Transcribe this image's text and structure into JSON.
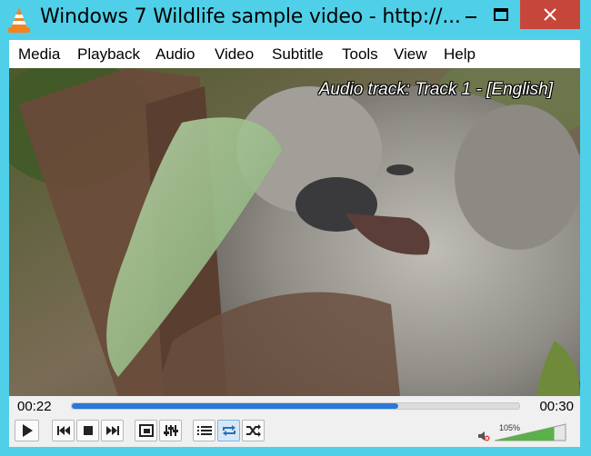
{
  "window": {
    "title": "Windows 7 Wildlife sample video - http://..."
  },
  "menu": {
    "items": [
      "Media",
      "Playback",
      "Audio",
      "Video",
      "Subtitle",
      "Tools",
      "View",
      "Help"
    ]
  },
  "video": {
    "osd_text": "Audio track: Track 1 - [English]"
  },
  "controls": {
    "elapsed": "00:22",
    "total": "00:30",
    "progress_fraction": 0.73,
    "volume_label": "105%",
    "volume_fraction": 1.05,
    "accent_color": "#2a78d8"
  },
  "icons": [
    "vlc-cone-icon",
    "minimize-icon",
    "maximize-icon",
    "close-icon",
    "play-icon",
    "previous-icon",
    "stop-icon",
    "next-icon",
    "fullscreen-icon",
    "extended-settings-icon",
    "playlist-icon",
    "loop-icon",
    "shuffle-icon",
    "mute-icon"
  ]
}
